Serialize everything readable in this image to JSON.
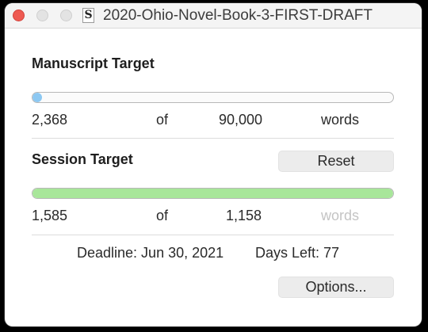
{
  "window": {
    "title": "2020-Ohio-Novel-Book-3-FIRST-DRAFT",
    "doc_icon_glyph": "S"
  },
  "manuscript": {
    "heading": "Manuscript Target",
    "current": "2,368",
    "of": "of",
    "target": "90,000",
    "unit": "words",
    "progress_fraction": 0.026,
    "bar_color": "#8cc8f2"
  },
  "session": {
    "heading": "Session Target",
    "reset_label": "Reset",
    "current": "1,585",
    "of": "of",
    "target": "1,158",
    "unit": "words",
    "progress_fraction": 1.0,
    "bar_color": "#a8e69a"
  },
  "deadline": {
    "text": "Deadline: Jun 30, 2021",
    "days_left": "Days Left: 77"
  },
  "options_label": "Options..."
}
